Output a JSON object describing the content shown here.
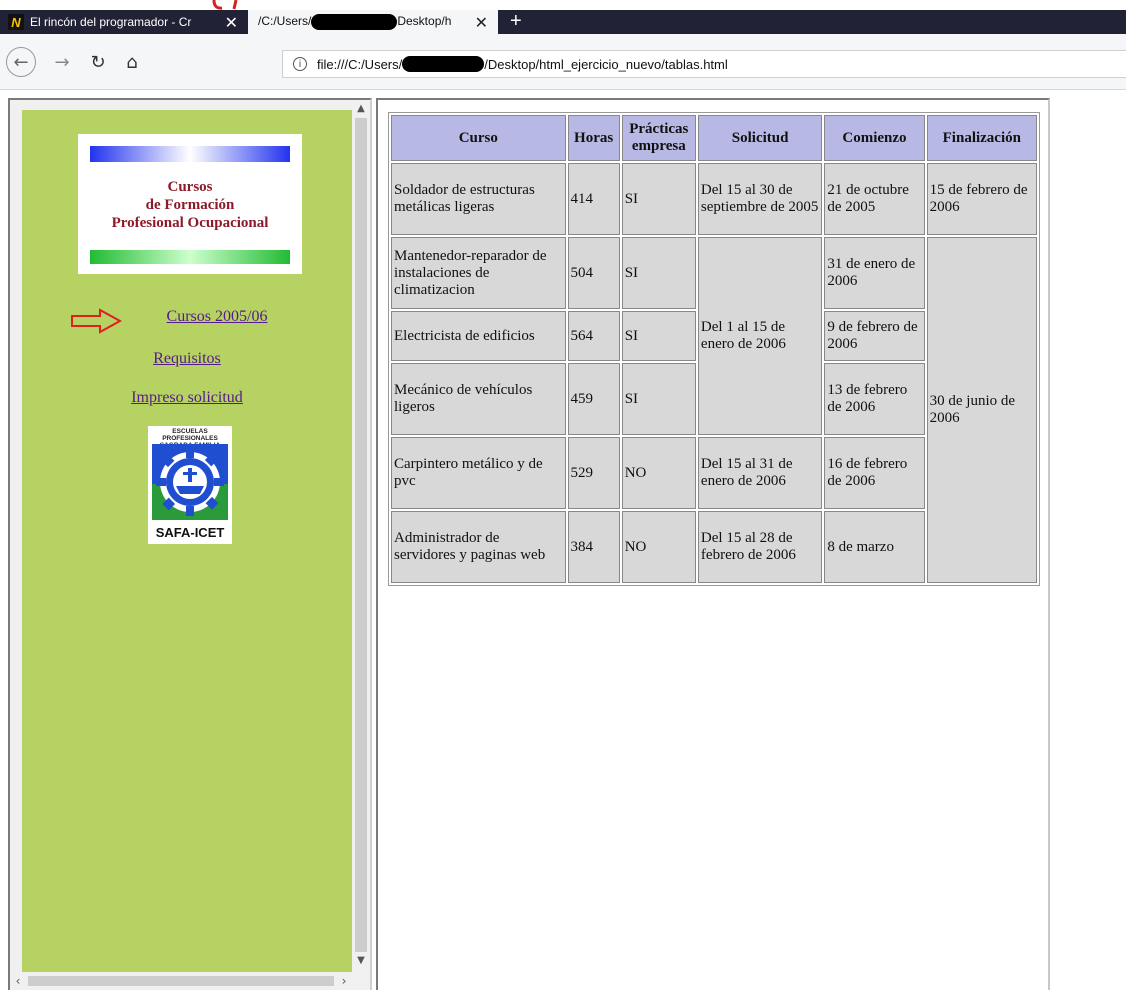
{
  "browser": {
    "tabs": [
      {
        "title": "El rincón del programador - Cr",
        "favicon": "N",
        "active": false
      },
      {
        "title": "/C:/Users/",
        "title_suffix": "Desktop/h",
        "active": true
      }
    ],
    "new_tab": "+",
    "url_prefix": "file:///C:/Users/",
    "url_suffix": "/Desktop/html_ejercicio_nuevo/tablas.html"
  },
  "sidebar": {
    "logo": {
      "line1": "Cursos",
      "line2": "de Formación",
      "line3": "Profesional Ocupacional"
    },
    "links": [
      {
        "label": "Cursos 2005/06"
      },
      {
        "label": "Requisitos"
      },
      {
        "label": "Impreso solicitud"
      }
    ],
    "badge": {
      "top_line1": "ESCUELAS PROFESIONALES",
      "top_line2": "SAGRADA FAMILIA",
      "bottom": "SAFA-ICET"
    },
    "background": "#b5d262"
  },
  "table": {
    "headers": {
      "curso": "Curso",
      "horas": "Horas",
      "practicas1": "Prácticas",
      "practicas2": "empresa",
      "solicitud": "Solicitud",
      "comienzo": "Comienzo",
      "finalizacion": "Finalización"
    },
    "rows": [
      {
        "curso": "Soldador de estructuras metálicas ligeras",
        "horas": "414",
        "practicas": "SI",
        "solicitud": "Del 15 al 30 de septiembre de 2005",
        "comienzo": "21 de octubre de 2005",
        "finalizacion": "15 de febrero de 2006"
      },
      {
        "curso": "Mantenedor-reparador de instalaciones de climatizacion",
        "horas": "504",
        "practicas": "SI",
        "comienzo": "31 de enero de 2006"
      },
      {
        "curso": "Electricista de edificios",
        "horas": "564",
        "practicas": "SI",
        "comienzo": "9 de febrero de 2006"
      },
      {
        "curso": "Mecánico de vehículos ligeros",
        "horas": "459",
        "practicas": "SI",
        "comienzo": "13 de febrero de 2006"
      },
      {
        "curso": "Carpintero metálico y de pvc",
        "horas": "529",
        "practicas": "NO",
        "solicitud": "Del 15 al 31 de enero de 2006",
        "comienzo": "16 de febrero de 2006"
      },
      {
        "curso": "Administrador de servidores y paginas web",
        "horas": "384",
        "practicas": "NO",
        "solicitud": "Del 15 al 28 de febrero de 2006",
        "comienzo": "8 de marzo"
      }
    ],
    "merged": {
      "solicitud_rows_2_4": "Del 1 al 15 de enero de 2006",
      "finalizacion_rows_2_6": "30 de junio de 2006"
    },
    "header_bg": "#b8b8e4",
    "cell_bg": "#d8d8d8"
  }
}
